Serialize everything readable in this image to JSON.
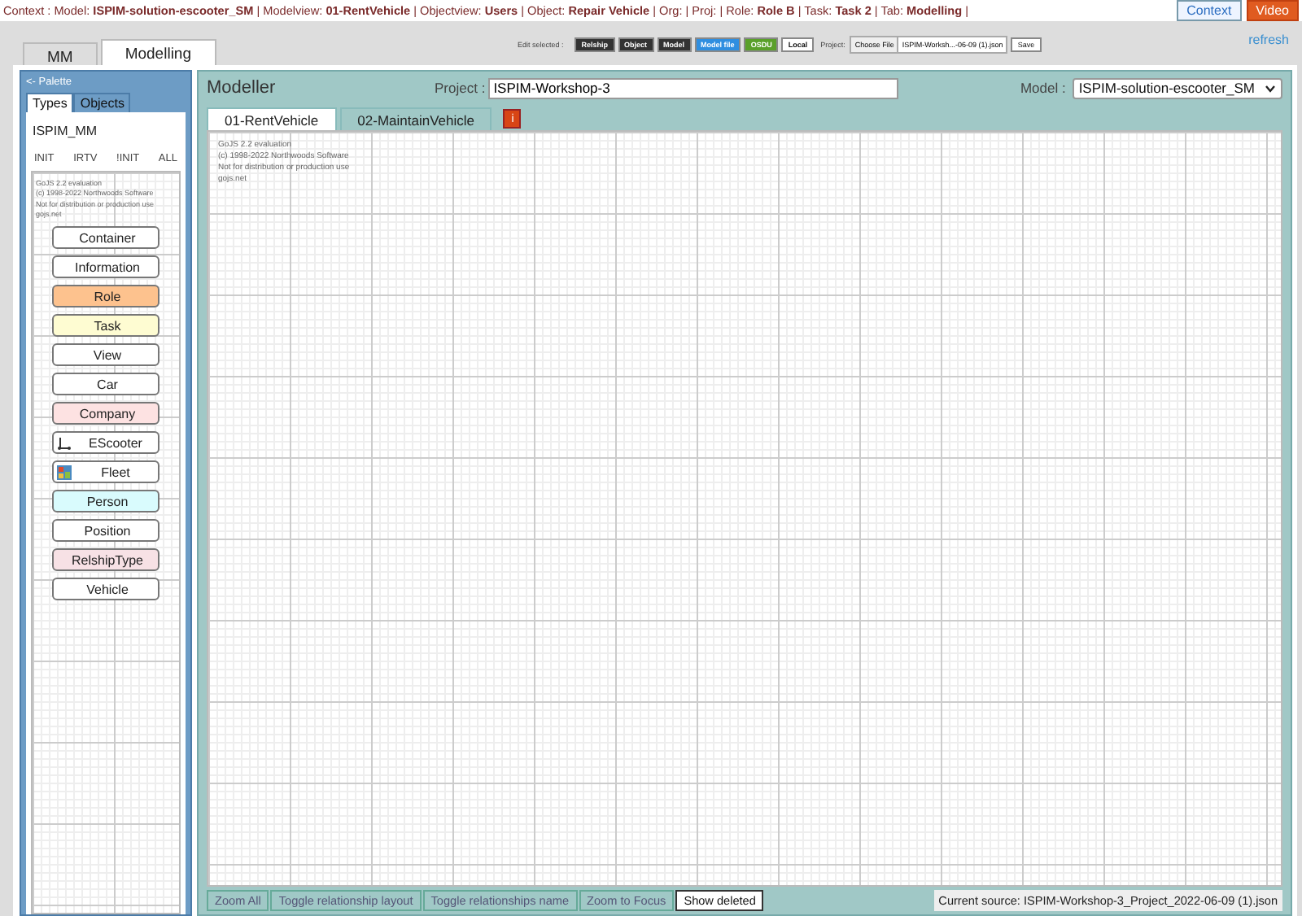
{
  "context_line": "Context : Model: **ISPIM-solution-escooter_SM** | Modelview: **01-RentVehicle** | Objectview: **Users** | Object: **Repair Vehicle** | Org: | Proj: | Role: **Role B** | Task: **Task 2** | Tab: **Modelling** |",
  "top_buttons": [
    {
      "label": "Context",
      "kind": "outline"
    },
    {
      "label": "Video",
      "kind": "accent"
    }
  ],
  "main_tabs": [
    {
      "label": "MM",
      "selected": false
    },
    {
      "label": "Modelling",
      "selected": true
    }
  ],
  "toolbar": {
    "label": "Edit selected :",
    "buttons": [
      {
        "label": "Relship",
        "kind": "dark"
      },
      {
        "label": "Object",
        "kind": "dark"
      },
      {
        "label": "Model",
        "kind": "dark"
      },
      {
        "label": "Model file",
        "kind": "blue"
      },
      {
        "label": "OSDU",
        "kind": "green"
      },
      {
        "label": "Local",
        "kind": "light"
      }
    ],
    "project_label": "Project:",
    "file_button": "Choose File",
    "file_name": "ISPIM-Worksh...-06-09 (1).json",
    "save": "Save"
  },
  "refresh": "refresh",
  "palette": {
    "header": "<- Palette",
    "tabs": [
      {
        "label": "Types",
        "selected": true
      },
      {
        "label": "Objects",
        "selected": false
      }
    ],
    "metamodel": "ISPIM_MM",
    "filters": [
      "INIT",
      "IRTV",
      "!INIT",
      "ALL"
    ],
    "watermark": [
      "GoJS 2.2 evaluation",
      "(c) 1998-2022 Northwoods Software",
      "Not for distribution or production use",
      "gojs.net"
    ],
    "items": [
      {
        "name": "Container",
        "color": "#ffffff",
        "kind": "plain"
      },
      {
        "name": "Information",
        "color": "#ffffff",
        "kind": "plain"
      },
      {
        "name": "Role",
        "color": "#fdc28e",
        "kind": "plain"
      },
      {
        "name": "Task",
        "color": "#fefcd2",
        "kind": "plain"
      },
      {
        "name": "View",
        "color": "#ffffff",
        "kind": "plain"
      },
      {
        "name": "Car",
        "color": "#ffffff",
        "kind": "plain"
      },
      {
        "name": "Company",
        "color": "#fde2e2",
        "kind": "plain"
      },
      {
        "name": "EScooter",
        "color": "#ffffff",
        "kind": "scooter"
      },
      {
        "name": "Fleet",
        "color": "#ffffff",
        "kind": "map"
      },
      {
        "name": "Person",
        "color": "#d9fbfd",
        "kind": "plain"
      },
      {
        "name": "Position",
        "color": "#ffffff",
        "kind": "plain"
      },
      {
        "name": "RelshipType",
        "color": "#f7e1e5",
        "kind": "plain"
      },
      {
        "name": "Vehicle",
        "color": "#ffffff",
        "kind": "plain"
      }
    ]
  },
  "modeller": {
    "title": "Modeller",
    "project_label": "Project :",
    "project_value": "ISPIM-Workshop-3",
    "model_label": "Model :",
    "model_value": "ISPIM-solution-escooter_SM",
    "tabs": [
      {
        "label": "01-RentVehicle",
        "selected": true
      },
      {
        "label": "02-MaintainVehicle",
        "selected": false
      }
    ],
    "info_button": "i",
    "watermark": [
      "GoJS 2.2 evaluation",
      "(c) 1998-2022 Northwoods Software",
      "Not for distribution or production use",
      "gojs.net"
    ],
    "bottom_buttons": [
      {
        "label": "Zoom All",
        "disabled": true
      },
      {
        "label": "Toggle relationship layout",
        "disabled": true
      },
      {
        "label": "Toggle relationships name",
        "disabled": true
      },
      {
        "label": "Zoom to Focus",
        "disabled": true
      },
      {
        "label": "Show deleted",
        "disabled": false
      }
    ],
    "current_source": "Current source: ISPIM-Workshop-3_Project_2022-06-09 (1).json"
  }
}
